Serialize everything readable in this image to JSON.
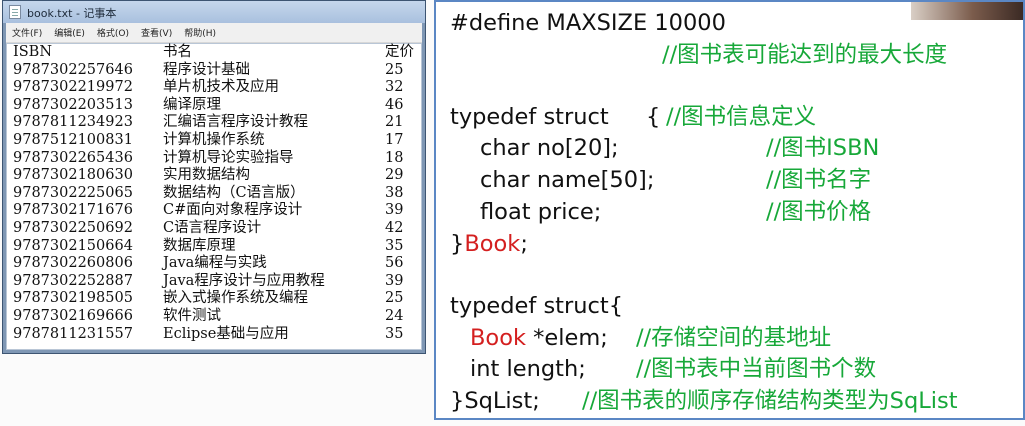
{
  "window": {
    "title": "book.txt - 记事本",
    "menu": [
      "文件(F)",
      "编辑(E)",
      "格式(O)",
      "查看(V)",
      "帮助(H)"
    ]
  },
  "table": {
    "headers": [
      "ISBN",
      "书名",
      "定价"
    ],
    "rows": [
      [
        "9787302257646",
        "程序设计基础",
        "25"
      ],
      [
        "9787302219972",
        "单片机技术及应用",
        "32"
      ],
      [
        "9787302203513",
        "编译原理",
        "46"
      ],
      [
        "9787811234923",
        "汇编语言程序设计教程",
        "21"
      ],
      [
        "9787512100831",
        "计算机操作系统",
        "17"
      ],
      [
        "9787302265436",
        "计算机导论实验指导",
        "18"
      ],
      [
        "9787302180630",
        "实用数据结构",
        "29"
      ],
      [
        "9787302225065",
        "数据结构（C语言版）",
        "38"
      ],
      [
        "9787302171676",
        "C#面向对象程序设计",
        "39"
      ],
      [
        "9787302250692",
        "C语言程序设计",
        "42"
      ],
      [
        "9787302150664",
        "数据库原理",
        "35"
      ],
      [
        "9787302260806",
        "Java编程与实践",
        "56"
      ],
      [
        "9787302252887",
        "Java程序设计与应用教程",
        "39"
      ],
      [
        "9787302198505",
        "嵌入式操作系统及编程",
        "25"
      ],
      [
        "9787302169666",
        "软件测试",
        "24"
      ],
      [
        "9787811231557",
        "Eclipse基础与应用",
        "35"
      ]
    ]
  },
  "code": {
    "define": "#define MAXSIZE 10000",
    "define_comment": "//图书表可能达到的最大长度",
    "typedef1": "typedef struct",
    "brace_open": "{",
    "typedef1_comment": "//图书信息定义",
    "f1": "char no[20];",
    "f1_comment": "//图书ISBN",
    "f2": "char name[50];",
    "f2_comment": "//图书名字",
    "f3": "float price;",
    "f3_comment": "//图书价格",
    "close1_brace": "}",
    "close1_name": "Book",
    "semicolon": ";",
    "typedef2": "typedef struct{",
    "elem_type": "Book",
    "elem_rest": " *elem;",
    "elem_comment": "//存储空间的基地址",
    "len": "int length;",
    "len_comment": "//图书表中当前图书个数",
    "close2": "}SqList;",
    "close2_comment": "//图书表的顺序存储结构类型为SqList"
  },
  "colors": {
    "comment": "#17a839",
    "keyword_red": "#d41f1f",
    "slide_border": "#5b87c4"
  }
}
